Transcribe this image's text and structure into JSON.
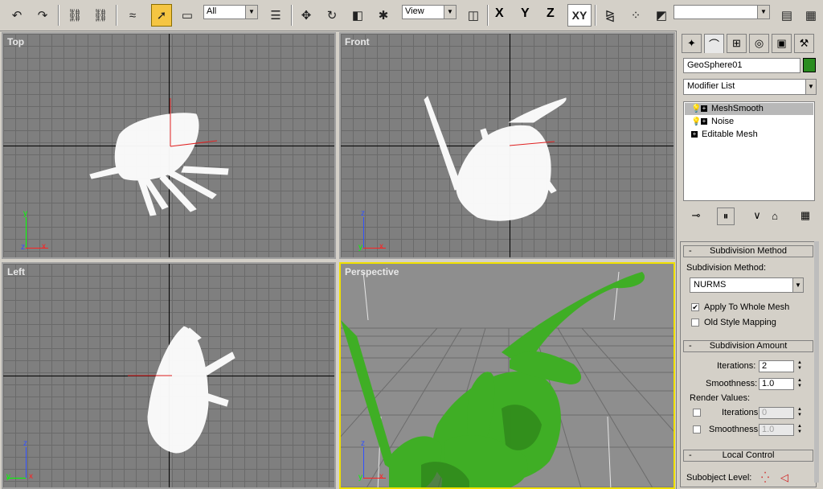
{
  "toolbar": {
    "selection_filter": "All",
    "coord_system": "View",
    "axis_x": "X",
    "axis_y": "Y",
    "axis_z": "Z",
    "axis_xy": "XY",
    "named_selection": ""
  },
  "viewports": {
    "top_label": "Top",
    "front_label": "Front",
    "left_label": "Left",
    "persp_label": "Perspective"
  },
  "gizmo_axes": {
    "x": "x",
    "y": "y",
    "z": "z"
  },
  "panel": {
    "object_name": "GeoSphere01",
    "object_color": "#2a8c1f",
    "modifier_list": "Modifier List",
    "stack": [
      {
        "label": "MeshSmooth",
        "selected": true,
        "bulb": true
      },
      {
        "label": "Noise",
        "selected": false,
        "bulb": true
      },
      {
        "label": "Editable Mesh",
        "selected": false,
        "bulb": false
      }
    ],
    "subdiv_method_title": "Subdivision Method",
    "subdiv_method_label": "Subdivision Method:",
    "subdiv_method_value": "NURMS",
    "apply_whole_mesh": "Apply To Whole Mesh",
    "old_style_mapping": "Old Style Mapping",
    "subdiv_amount_title": "Subdivision Amount",
    "iterations_label": "Iterations:",
    "iterations_value": "2",
    "smoothness_label": "Smoothness:",
    "smoothness_value": "1.0",
    "render_values_label": "Render Values:",
    "render_iterations_label": "Iterations:",
    "render_iterations_value": "0",
    "render_smoothness_label": "Smoothness:",
    "render_smoothness_value": "1.0",
    "local_control_title": "Local Control",
    "subobject_level_label": "Subobject Level:"
  },
  "colors": {
    "viewport_bg": "#7f7f7f",
    "active_viewport_border": "#f0e000",
    "mesh_green": "#3fae25",
    "wire_white": "#ffffff"
  }
}
